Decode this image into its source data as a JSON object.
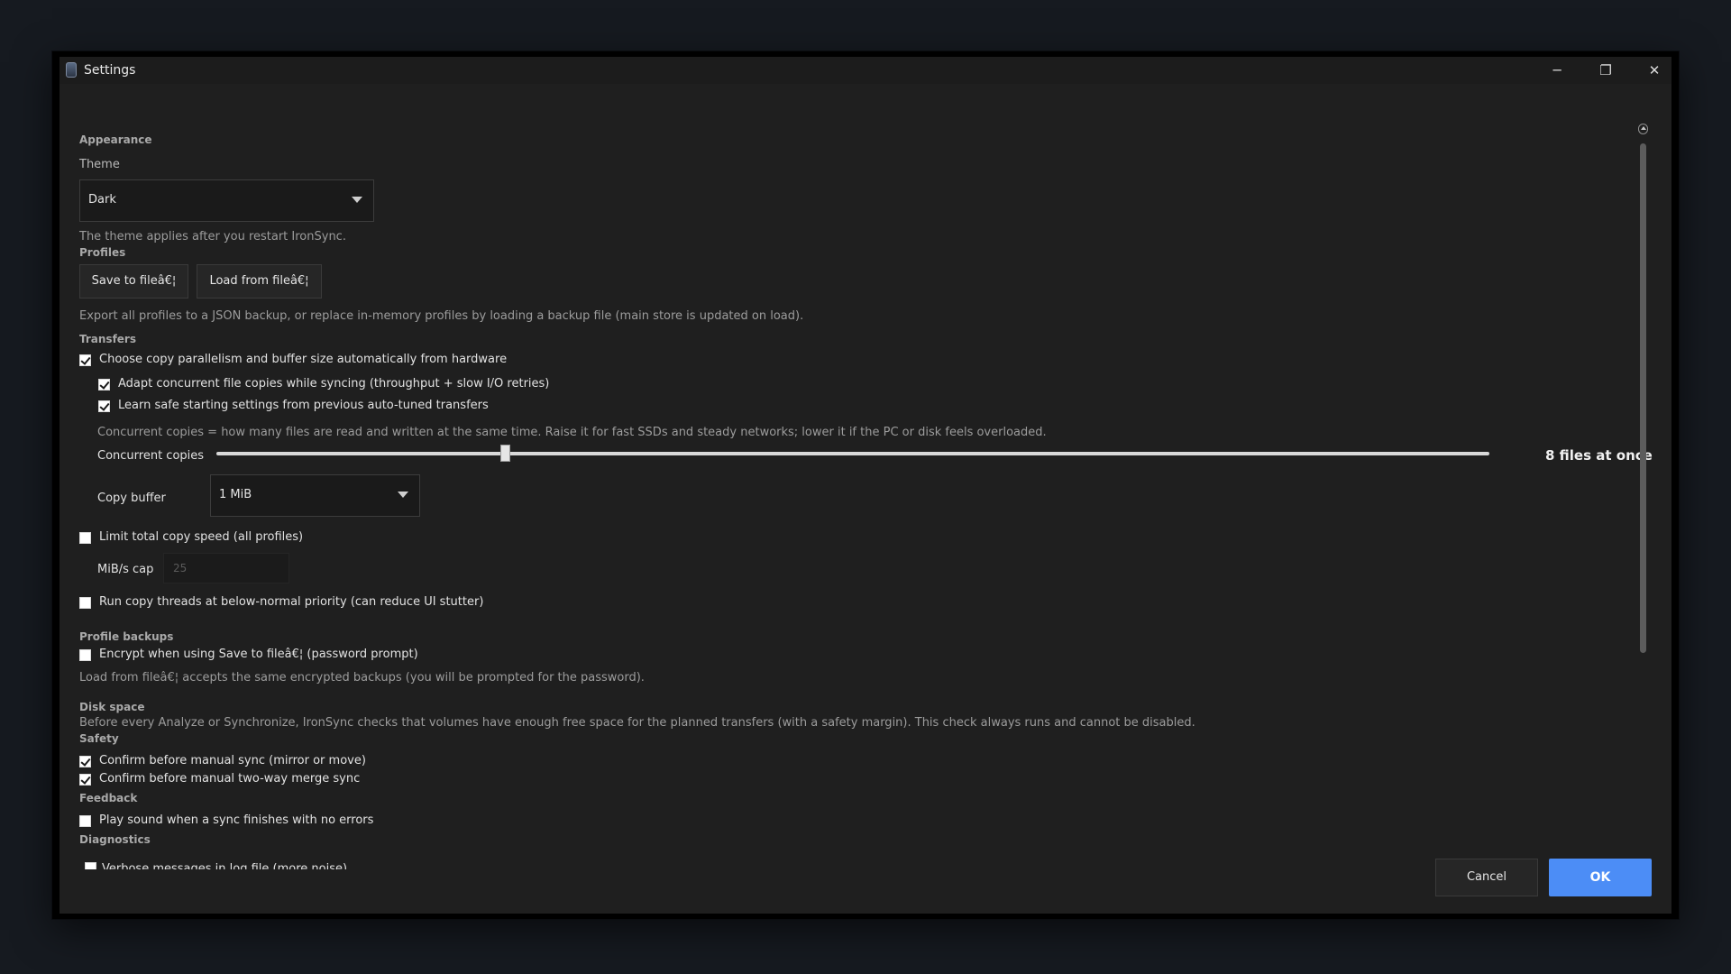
{
  "window": {
    "title": "Settings",
    "controls": {
      "minimize": "─",
      "maximize": "❐",
      "close": "✕"
    }
  },
  "appearance": {
    "heading": "Appearance",
    "theme_label": "Theme",
    "theme_value": "Dark",
    "theme_hint": "The theme applies after you restart IronSync."
  },
  "profiles": {
    "heading": "Profiles",
    "save_button": "Save to fileâ€¦",
    "load_button": "Load from fileâ€¦",
    "hint": "Export all profiles to a JSON backup, or replace in-memory profiles by loading a backup file (main store is updated on load)."
  },
  "transfers": {
    "heading": "Transfers",
    "auto_tune": {
      "label": "Choose copy parallelism and buffer size automatically from hardware",
      "checked": true
    },
    "adapt_copies": {
      "label": "Adapt concurrent file copies while syncing (throughput + slow I/O retries)",
      "checked": true
    },
    "learn_settings": {
      "label": "Learn safe starting settings from previous auto-tuned transfers",
      "checked": true
    },
    "concurrency_hint": "Concurrent copies = how many files are read and written at the same time. Raise it for fast SSDs and steady networks; lower it if the PC or disk feels overloaded.",
    "concurrent_label": "Concurrent copies",
    "concurrent_value_text": "8 files at once",
    "concurrent_slider_fraction": 0.2265,
    "copy_buffer_label": "Copy buffer",
    "copy_buffer_value": "1 MiB",
    "limit_speed": {
      "label": "Limit total copy speed (all profiles)",
      "checked": false
    },
    "cap_label": "MiB/s cap",
    "cap_placeholder": "25",
    "low_priority": {
      "label": "Run copy threads at below-normal priority (can reduce UI stutter)",
      "checked": false
    }
  },
  "profile_backups": {
    "heading": "Profile backups",
    "encrypt": {
      "label": "Encrypt when using Save to fileâ€¦ (password prompt)",
      "checked": false
    },
    "hint": "Load from fileâ€¦ accepts the same encrypted backups (you will be prompted for the password)."
  },
  "disk_space": {
    "heading": "Disk space",
    "hint": "Before every Analyze or Synchronize, IronSync checks that volumes have enough free space for the planned transfers (with a safety margin). This check always runs and cannot be disabled."
  },
  "safety": {
    "heading": "Safety",
    "confirm_manual": {
      "label": "Confirm before manual sync (mirror or move)",
      "checked": true
    },
    "confirm_merge": {
      "label": "Confirm before manual two-way merge sync",
      "checked": true
    }
  },
  "feedback": {
    "heading": "Feedback",
    "play_sound": {
      "label": "Play sound when a sync finishes with no errors",
      "checked": false
    }
  },
  "diagnostics": {
    "heading": "Diagnostics",
    "verbose": {
      "label": "Verbose messages in log file (more noise)",
      "checked": false
    }
  },
  "footer": {
    "cancel": "Cancel",
    "ok": "OK"
  },
  "colors": {
    "accent": "#4c8df6",
    "window_bg": "#1f1f1f",
    "section_heading": "#a9a9a9",
    "hint_text": "#9c9c9c"
  }
}
